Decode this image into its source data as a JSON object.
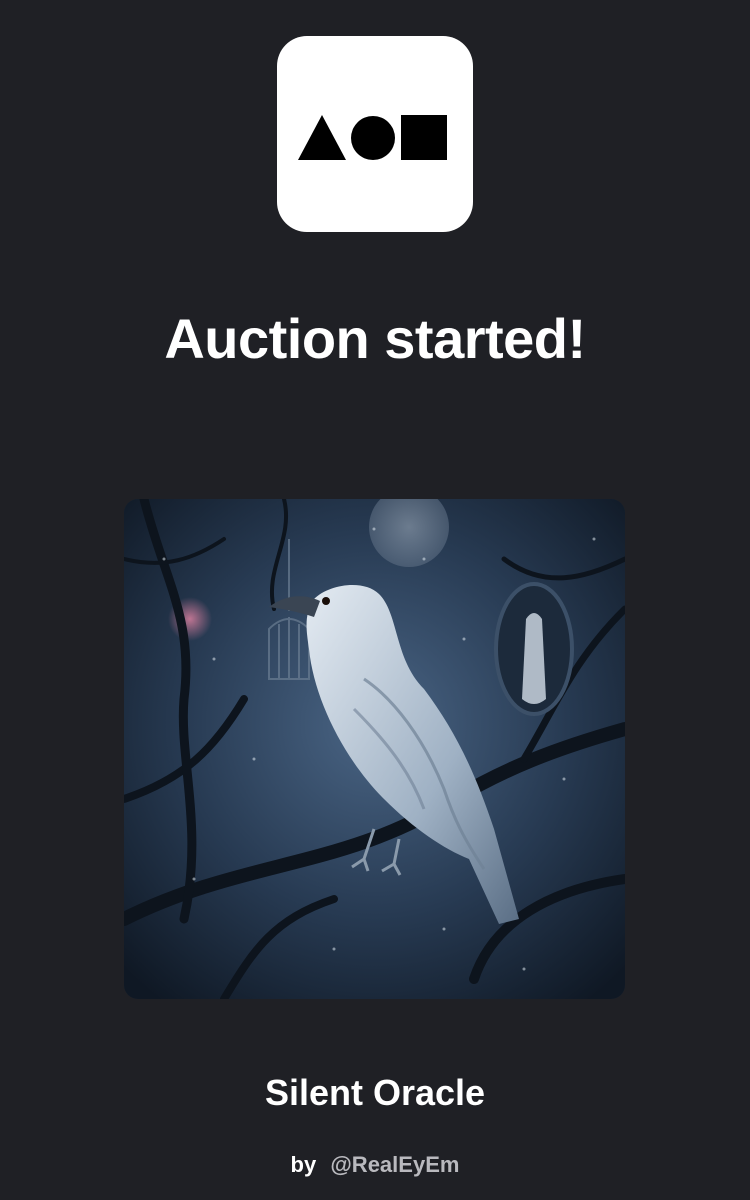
{
  "header": {
    "logo_icon": "shapes-logo-icon",
    "title": "Auction started!"
  },
  "artwork": {
    "image_icon": "white-raven-artwork",
    "name": "Silent Oracle",
    "by_label": "by",
    "artist_handle": "@RealEyEm"
  },
  "colors": {
    "background": "#1f2025",
    "logo_bg": "#ffffff",
    "title": "#ffffff",
    "handle": "#b9b9be"
  }
}
